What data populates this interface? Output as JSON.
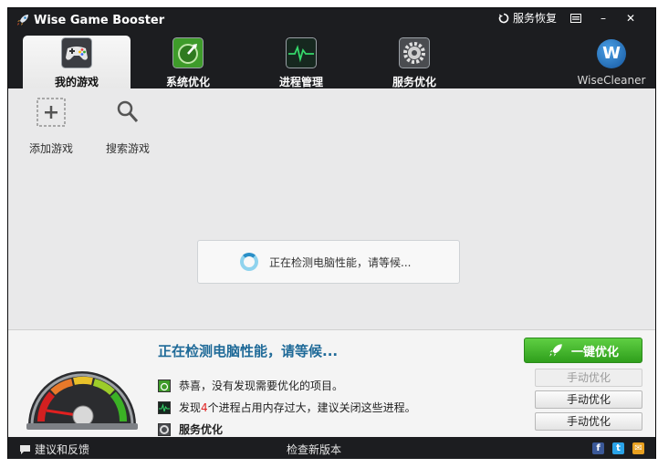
{
  "app": {
    "title": "Wise Game Booster",
    "restore_label": "服务恢复",
    "min_label": "–",
    "close_label": "✕",
    "menu_icon": "menu-icon"
  },
  "nav": {
    "tabs": [
      {
        "label": "我的游戏",
        "icon": "gamepad-icon",
        "active": true
      },
      {
        "label": "系统优化",
        "icon": "system-optimize-icon",
        "active": false
      },
      {
        "label": "进程管理",
        "icon": "process-monitor-icon",
        "active": false
      },
      {
        "label": "服务优化",
        "icon": "service-gear-icon",
        "active": false
      }
    ],
    "brand": {
      "logo_letter": "W",
      "name": "WiseCleaner"
    }
  },
  "actions": {
    "add_game": "添加游戏",
    "search_game": "搜索游戏"
  },
  "loader": {
    "text": "正在检测电脑性能，请等候..."
  },
  "status": {
    "title": "正在检测电脑性能，请等候...",
    "row1": "恭喜，没有发现需要优化的项目。",
    "row2_prefix": "发现",
    "row2_count": "4",
    "row2_suffix": "个进程占用内存过大，建议关闭这些进程。",
    "row3": "服务优化"
  },
  "buttons": {
    "boost_all": "一键优化",
    "manual1": "手动优化",
    "manual2": "手动优化",
    "manual3": "手动优化"
  },
  "footer": {
    "feedback": "建议和反馈",
    "check_update": "检查新版本",
    "social": {
      "facebook": "f",
      "twitter": "t",
      "email": "✉"
    }
  },
  "colors": {
    "accent_blue": "#1f6a98",
    "boost_green": "#3bb125",
    "highlight_red": "#e02020",
    "dark_bg": "#1c1d20"
  }
}
